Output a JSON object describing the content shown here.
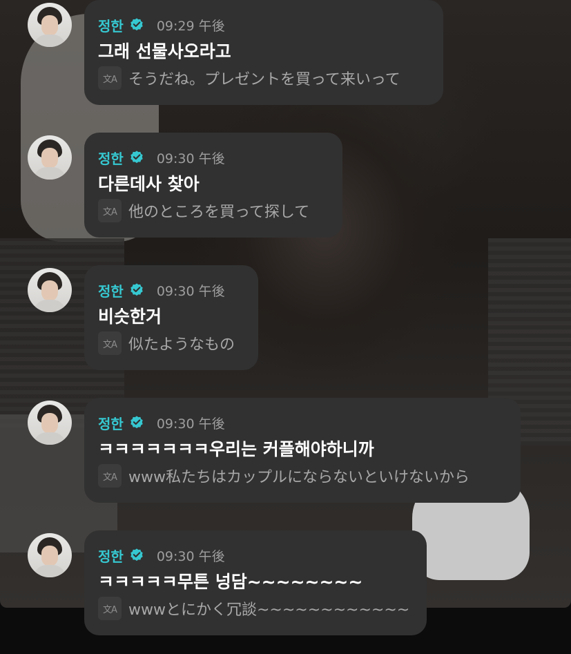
{
  "app": {
    "accent_color": "#36c8d1",
    "bubble_color": "#313131",
    "text_color": "#ffffff",
    "time_color": "#9e9e9e",
    "translate_icon": "translate-icon",
    "verified_icon": "verified-check-icon"
  },
  "messages": [
    {
      "name": "정한",
      "time": "09:29 午後",
      "text": "그래 선물사오라고",
      "translation": "そうだね。プレゼントを買って来いって"
    },
    {
      "name": "정한",
      "time": "09:30 午後",
      "text": "다른데사 찾아",
      "translation": "他のところを買って探して"
    },
    {
      "name": "정한",
      "time": "09:30 午後",
      "text": "비슷한거",
      "translation": "似たようなもの"
    },
    {
      "name": "정한",
      "time": "09:30 午後",
      "text": "ㅋㅋㅋㅋㅋㅋㅋ우리는 커플해야하니까",
      "translation": "www私たちはカップルにならないといけないから"
    },
    {
      "name": "정한",
      "time": "09:30 午後",
      "text": "ㅋㅋㅋㅋㅋ무튼 넝담~~~~~~~~",
      "translation": "wwwとにかく冗談~~~~~~~~~~~~"
    }
  ]
}
